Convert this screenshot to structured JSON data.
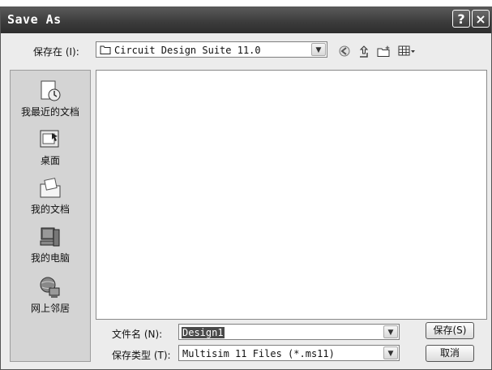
{
  "window": {
    "title": "Save As",
    "help_glyph": "?",
    "close_glyph": "×"
  },
  "location": {
    "label": "保存在 (I):",
    "value": "Circuit Design Suite 11.0"
  },
  "toolbar": {
    "back_icon": "back-icon",
    "up_icon": "up-folder-icon",
    "new_folder_icon": "new-folder-icon",
    "views_icon": "views-menu-icon"
  },
  "places": [
    {
      "label": "我最近的文档",
      "icon": "recent-documents-icon"
    },
    {
      "label": "桌面",
      "icon": "desktop-icon"
    },
    {
      "label": "我的文档",
      "icon": "my-documents-icon"
    },
    {
      "label": "我的电脑",
      "icon": "my-computer-icon"
    },
    {
      "label": "网上邻居",
      "icon": "network-places-icon"
    }
  ],
  "filename": {
    "label": "文件名 (N):",
    "value": "Design1"
  },
  "filetype": {
    "label": "保存类型 (T):",
    "value": "Multisim 11 Files (*.ms11)"
  },
  "buttons": {
    "save": "保存(S)",
    "cancel": "取消"
  }
}
